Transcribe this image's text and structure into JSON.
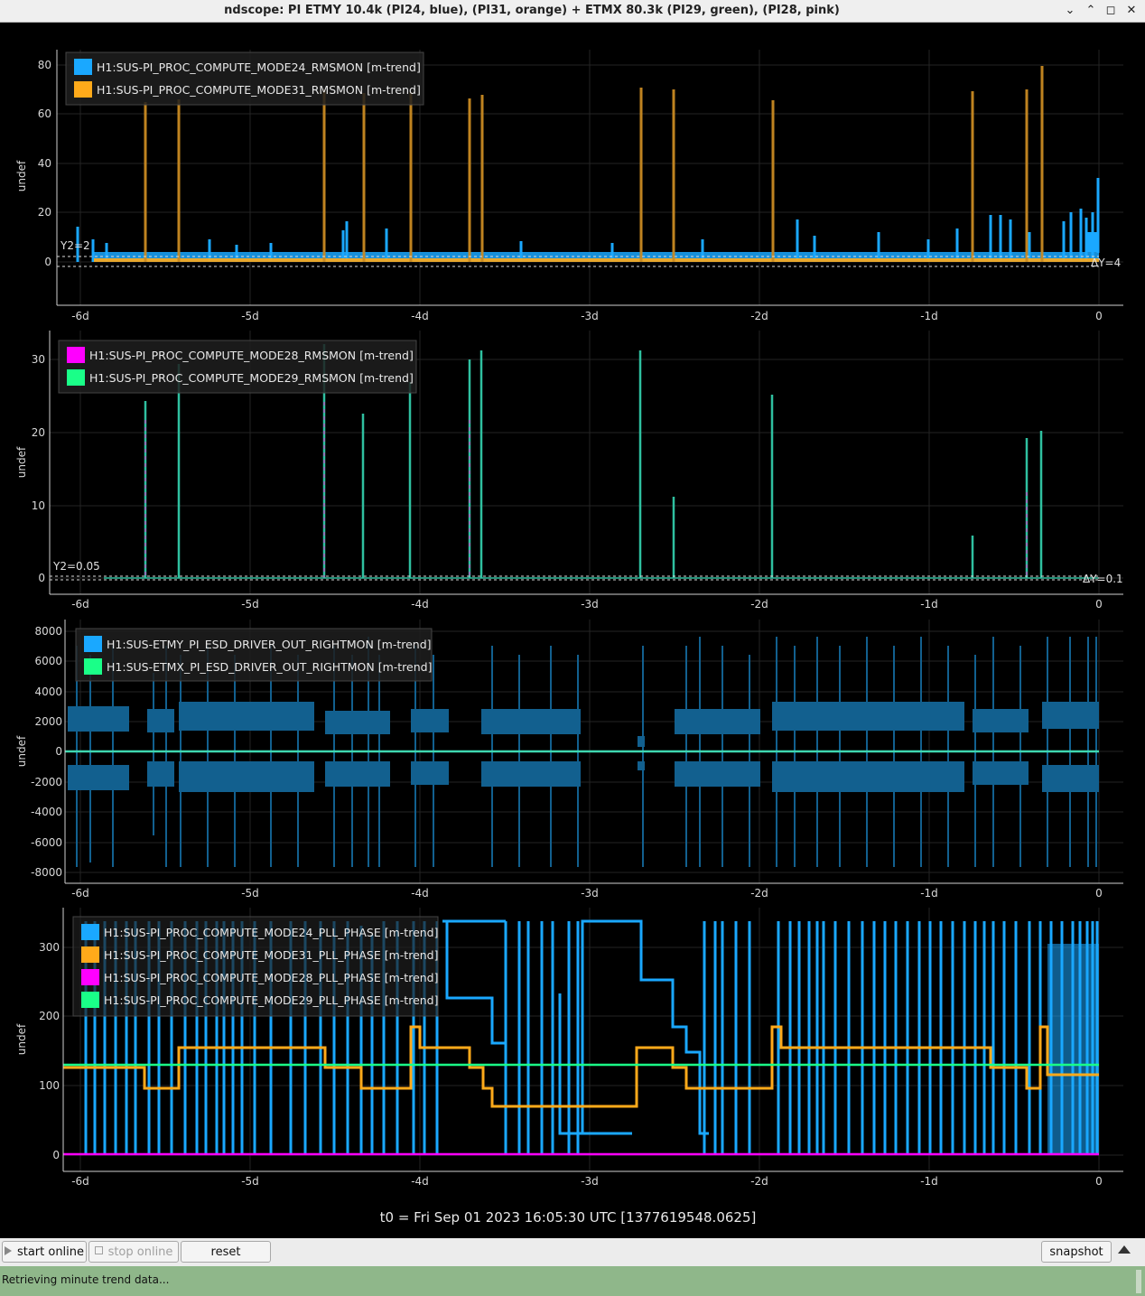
{
  "window": {
    "title": "ndscope: PI ETMY 10.4k (PI24, blue), (PI31, orange) + ETMX 80.3k (PI29, green), (PI28, pink)",
    "controls": [
      "⌄",
      "⌃",
      "◻",
      "✕"
    ]
  },
  "colors": {
    "background": "#000000",
    "axis": "#d0d0d0",
    "grid": "#2a2a2a",
    "blue": "#1aa8ff",
    "orange": "#ffaa1a",
    "pink": "#ff00ff",
    "green": "#1aff88",
    "status_bar": "#8fb78a"
  },
  "x_ticks": [
    "-6d",
    "-5d",
    "-4d",
    "-3d",
    "-2d",
    "-1d",
    "0"
  ],
  "plots": [
    {
      "ylabel": "undef",
      "y_ticks": [
        "80",
        "60",
        "40",
        "20",
        "0"
      ],
      "legend": [
        {
          "label": "H1:SUS-PI_PROC_COMPUTE_MODE24_RMSMON [m-trend]",
          "color": "#1aa8ff"
        },
        {
          "label": "H1:SUS-PI_PROC_COMPUTE_MODE31_RMSMON [m-trend]",
          "color": "#ffaa1a"
        }
      ],
      "cursor_y2_label": "Y2=2",
      "cursor_dy_label": "ΔY=4"
    },
    {
      "ylabel": "undef",
      "y_ticks": [
        "30",
        "20",
        "10",
        "0"
      ],
      "legend": [
        {
          "label": "H1:SUS-PI_PROC_COMPUTE_MODE28_RMSMON [m-trend]",
          "color": "#ff00ff"
        },
        {
          "label": "H1:SUS-PI_PROC_COMPUTE_MODE29_RMSMON [m-trend]",
          "color": "#1aff88"
        }
      ],
      "cursor_y2_label": "Y2=0.05",
      "cursor_dy_label": "ΔY=0.1"
    },
    {
      "ylabel": "undef",
      "y_ticks": [
        "8000",
        "6000",
        "4000",
        "2000",
        "0",
        "-2000",
        "-4000",
        "-6000",
        "-8000"
      ],
      "legend": [
        {
          "label": "H1:SUS-ETMY_PI_ESD_DRIVER_OUT_RIGHTMON [m-trend]",
          "color": "#1aa8ff"
        },
        {
          "label": "H1:SUS-ETMX_PI_ESD_DRIVER_OUT_RIGHTMON [m-trend]",
          "color": "#1aff88"
        }
      ]
    },
    {
      "ylabel": "undef",
      "y_ticks": [
        "300",
        "200",
        "100",
        "0"
      ],
      "legend": [
        {
          "label": "H1:SUS-PI_PROC_COMPUTE_MODE24_PLL_PHASE [m-trend]",
          "color": "#1aa8ff"
        },
        {
          "label": "H1:SUS-PI_PROC_COMPUTE_MODE31_PLL_PHASE [m-trend]",
          "color": "#ffaa1a"
        },
        {
          "label": "H1:SUS-PI_PROC_COMPUTE_MODE28_PLL_PHASE [m-trend]",
          "color": "#ff00ff"
        },
        {
          "label": "H1:SUS-PI_PROC_COMPUTE_MODE29_PLL_PHASE [m-trend]",
          "color": "#1aff88"
        }
      ]
    }
  ],
  "t0_label": "t0 = Fri Sep 01 2023 16:05:30 UTC [1377619548.0625]",
  "toolbar": {
    "start_online": "start online",
    "stop_online": "stop online",
    "reset": "reset",
    "snapshot": "snapshot"
  },
  "status": "Retrieving minute trend data..."
}
